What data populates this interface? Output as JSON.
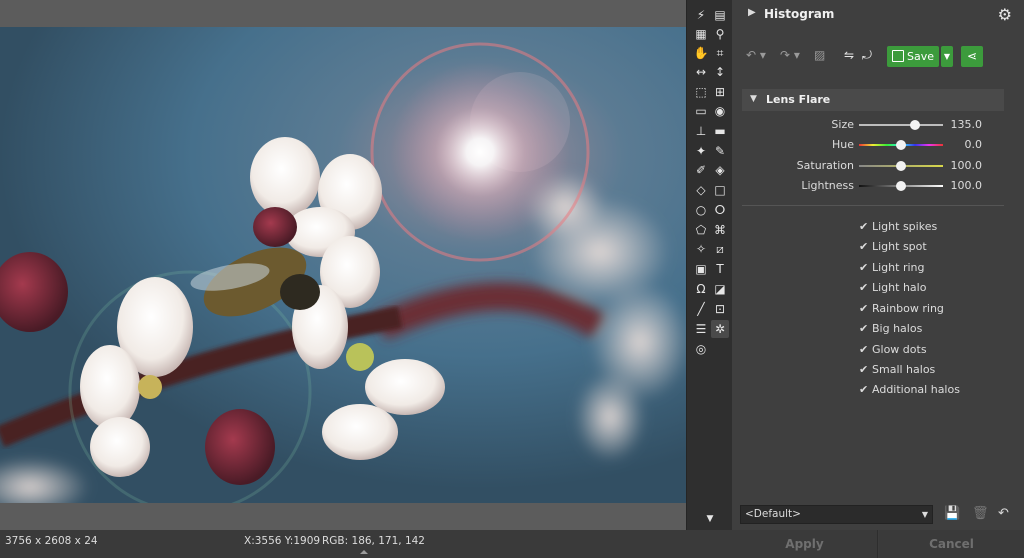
{
  "histogram": {
    "title": "Histogram"
  },
  "actions": {
    "save_label": "Save"
  },
  "lens_flare": {
    "title": "Lens Flare",
    "sliders": [
      {
        "label": "Size",
        "value": "135.0",
        "level": 0.67
      },
      {
        "label": "Hue",
        "value": "0.0",
        "level": 0.5
      },
      {
        "label": "Saturation",
        "value": "100.0",
        "level": 0.5
      },
      {
        "label": "Lightness",
        "value": "100.0",
        "level": 0.5
      }
    ],
    "options": [
      {
        "label": "Light spikes",
        "checked": true
      },
      {
        "label": "Light spot",
        "checked": true
      },
      {
        "label": "Light ring",
        "checked": true
      },
      {
        "label": "Light halo",
        "checked": true
      },
      {
        "label": "Rainbow ring",
        "checked": true
      },
      {
        "label": "Big halos",
        "checked": true
      },
      {
        "label": "Glow dots",
        "checked": true
      },
      {
        "label": "Small halos",
        "checked": true
      },
      {
        "label": "Additional halos",
        "checked": true
      }
    ]
  },
  "preset": {
    "value": "<Default>"
  },
  "footer": {
    "apply_label": "Apply",
    "cancel_label": "Cancel"
  },
  "status": {
    "dimensions": "3756 x 2608 x 24",
    "coords": "X:3556 Y:1909",
    "rgb": "RGB: 186, 171, 142"
  },
  "colors": {
    "accent_green": "#3c9b3c",
    "panel_bg": "#3f3f3f"
  },
  "tools": [
    "lightning-icon",
    "layers-icon",
    "grid-icon",
    "search-icon",
    "hand-icon",
    "crop-icon",
    "horizontal-resize-icon",
    "vertical-resize-icon",
    "transform-icon",
    "transform-points-icon",
    "gradient-icon",
    "eye-icon",
    "stamp-icon",
    "eraser-icon",
    "magic-wand-icon",
    "brush-correction-icon",
    "brush-icon",
    "bucket-icon",
    "eraser-tool-icon",
    "rectangle-select-icon",
    "ellipse-select-icon",
    "lasso-icon",
    "polygon-select-icon",
    "magnetic-lasso-icon",
    "magic-select-icon",
    "edit-icon",
    "clipboard-icon",
    "text-icon",
    "omega-icon",
    "shape-icon",
    "line-icon",
    "frame-icon",
    "hamburger-icon",
    "sun-icon",
    "target-icon",
    "scroll-down-icon"
  ]
}
